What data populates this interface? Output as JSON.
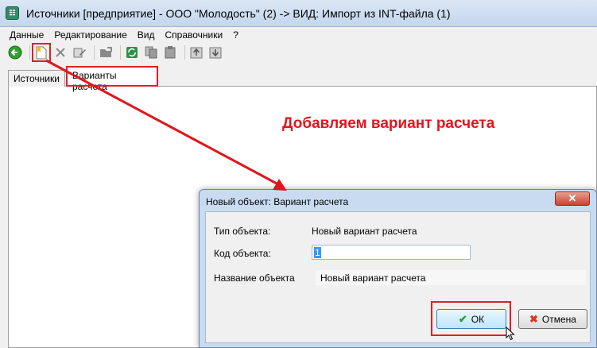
{
  "window": {
    "title": "Источники [предприятие] - ООО \"Молодость\" (2) -> ВИД: Импорт из INT-файла (1)"
  },
  "menu": {
    "items": [
      "Данные",
      "Редактирование",
      "Вид",
      "Справочники",
      "?"
    ]
  },
  "toolbar": {
    "icons": [
      "back-icon",
      "new-object-icon",
      "delete-icon",
      "edit-icon",
      "open-icon",
      "refresh-icon",
      "copy-icon",
      "paste-icon",
      "import-icon",
      "export-icon"
    ]
  },
  "tabs": [
    {
      "label": "Источники",
      "active": false
    },
    {
      "label": "Варианты расчета",
      "active": true
    }
  ],
  "annotation": {
    "text": "Добавляем вариант расчета",
    "color": "#e0161e"
  },
  "dialog": {
    "title": "Новый объект: Вариант расчета",
    "close_glyph": "✕",
    "type_label": "Тип объекта:",
    "type_value": "Новый вариант расчета",
    "code_label": "Код объекта:",
    "code_value": "1",
    "name_label": "Название объекта",
    "name_value": "Новый вариант расчета",
    "ok_label": "ОК",
    "cancel_label": "Отмена"
  }
}
